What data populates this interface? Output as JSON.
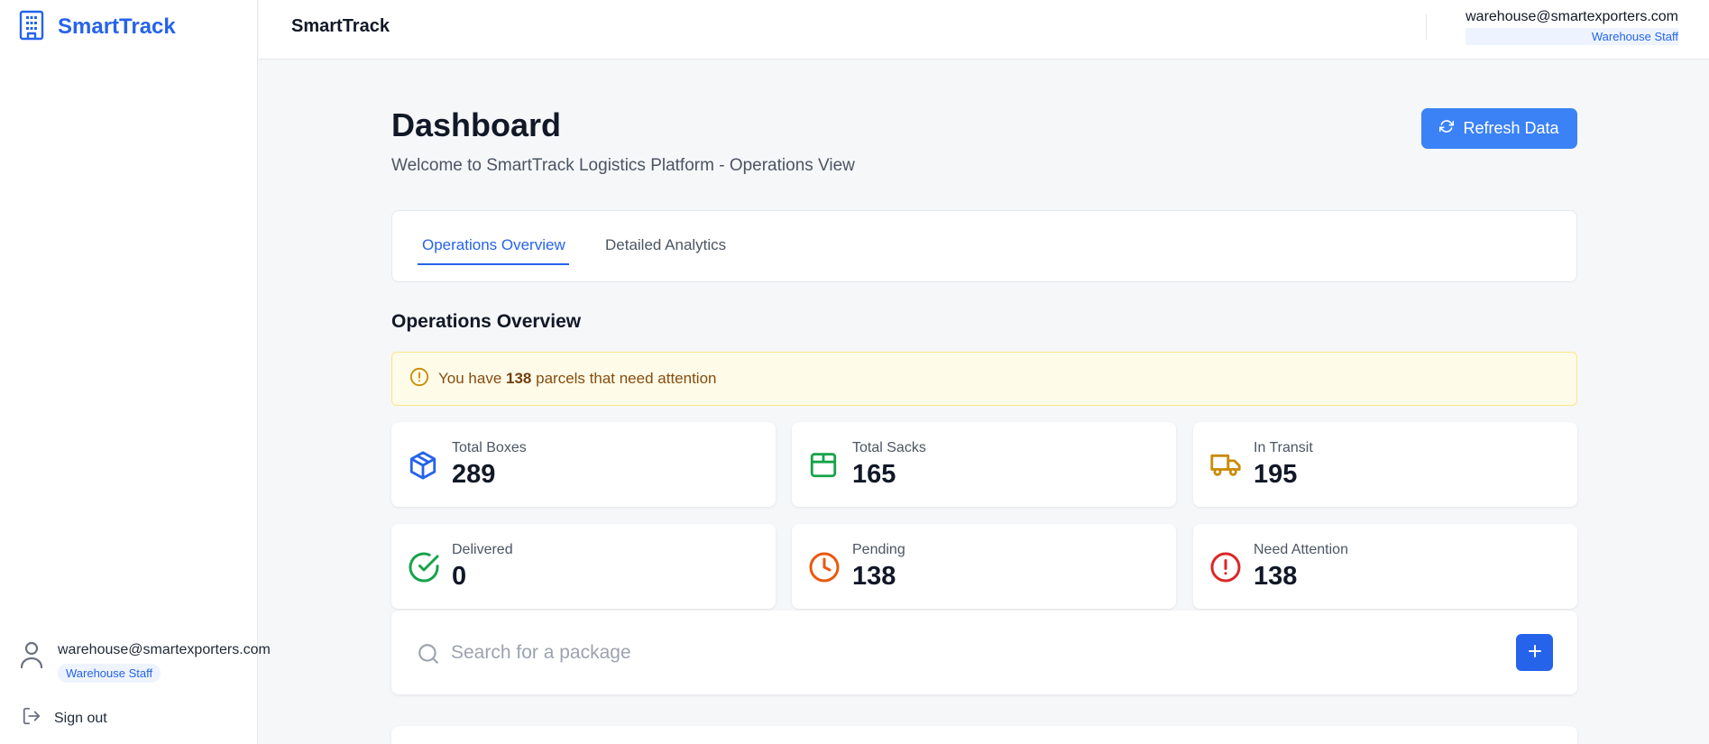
{
  "app": {
    "name": "SmartTrack"
  },
  "topbar": {
    "title": "SmartTrack",
    "user_email": "warehouse@smartexporters.com",
    "user_role": "Warehouse Staff"
  },
  "sidebar": {
    "user_email": "warehouse@smartexporters.com",
    "user_role": "Warehouse Staff",
    "signout_label": "Sign out"
  },
  "page": {
    "title": "Dashboard",
    "subtitle": "Welcome to SmartTrack Logistics Platform - Operations View",
    "refresh_label": "Refresh Data"
  },
  "tabs": [
    {
      "label": "Operations Overview",
      "active": true
    },
    {
      "label": "Detailed Analytics",
      "active": false
    }
  ],
  "section": {
    "title": "Operations Overview"
  },
  "alert": {
    "prefix": "You have",
    "count": "138",
    "suffix": "parcels that need attention"
  },
  "stats": [
    {
      "label": "Total Boxes",
      "value": "289",
      "icon": "box-icon",
      "color": "#2563eb"
    },
    {
      "label": "Total Sacks",
      "value": "165",
      "icon": "package-icon",
      "color": "#16a34a"
    },
    {
      "label": "In Transit",
      "value": "195",
      "icon": "truck-icon",
      "color": "#ca8a04"
    },
    {
      "label": "Delivered",
      "value": "0",
      "icon": "check-circle-icon",
      "color": "#16a34a"
    },
    {
      "label": "Pending",
      "value": "138",
      "icon": "clock-icon",
      "color": "#ea580c"
    },
    {
      "label": "Need Attention",
      "value": "138",
      "icon": "alert-circle-icon",
      "color": "#dc2626"
    }
  ],
  "search": {
    "placeholder": "Search for a package"
  },
  "colors": {
    "accent": "#2563eb",
    "refresh_button": "#3b82f6",
    "alert_bg": "#fefbe8",
    "alert_border": "#fde68a"
  }
}
